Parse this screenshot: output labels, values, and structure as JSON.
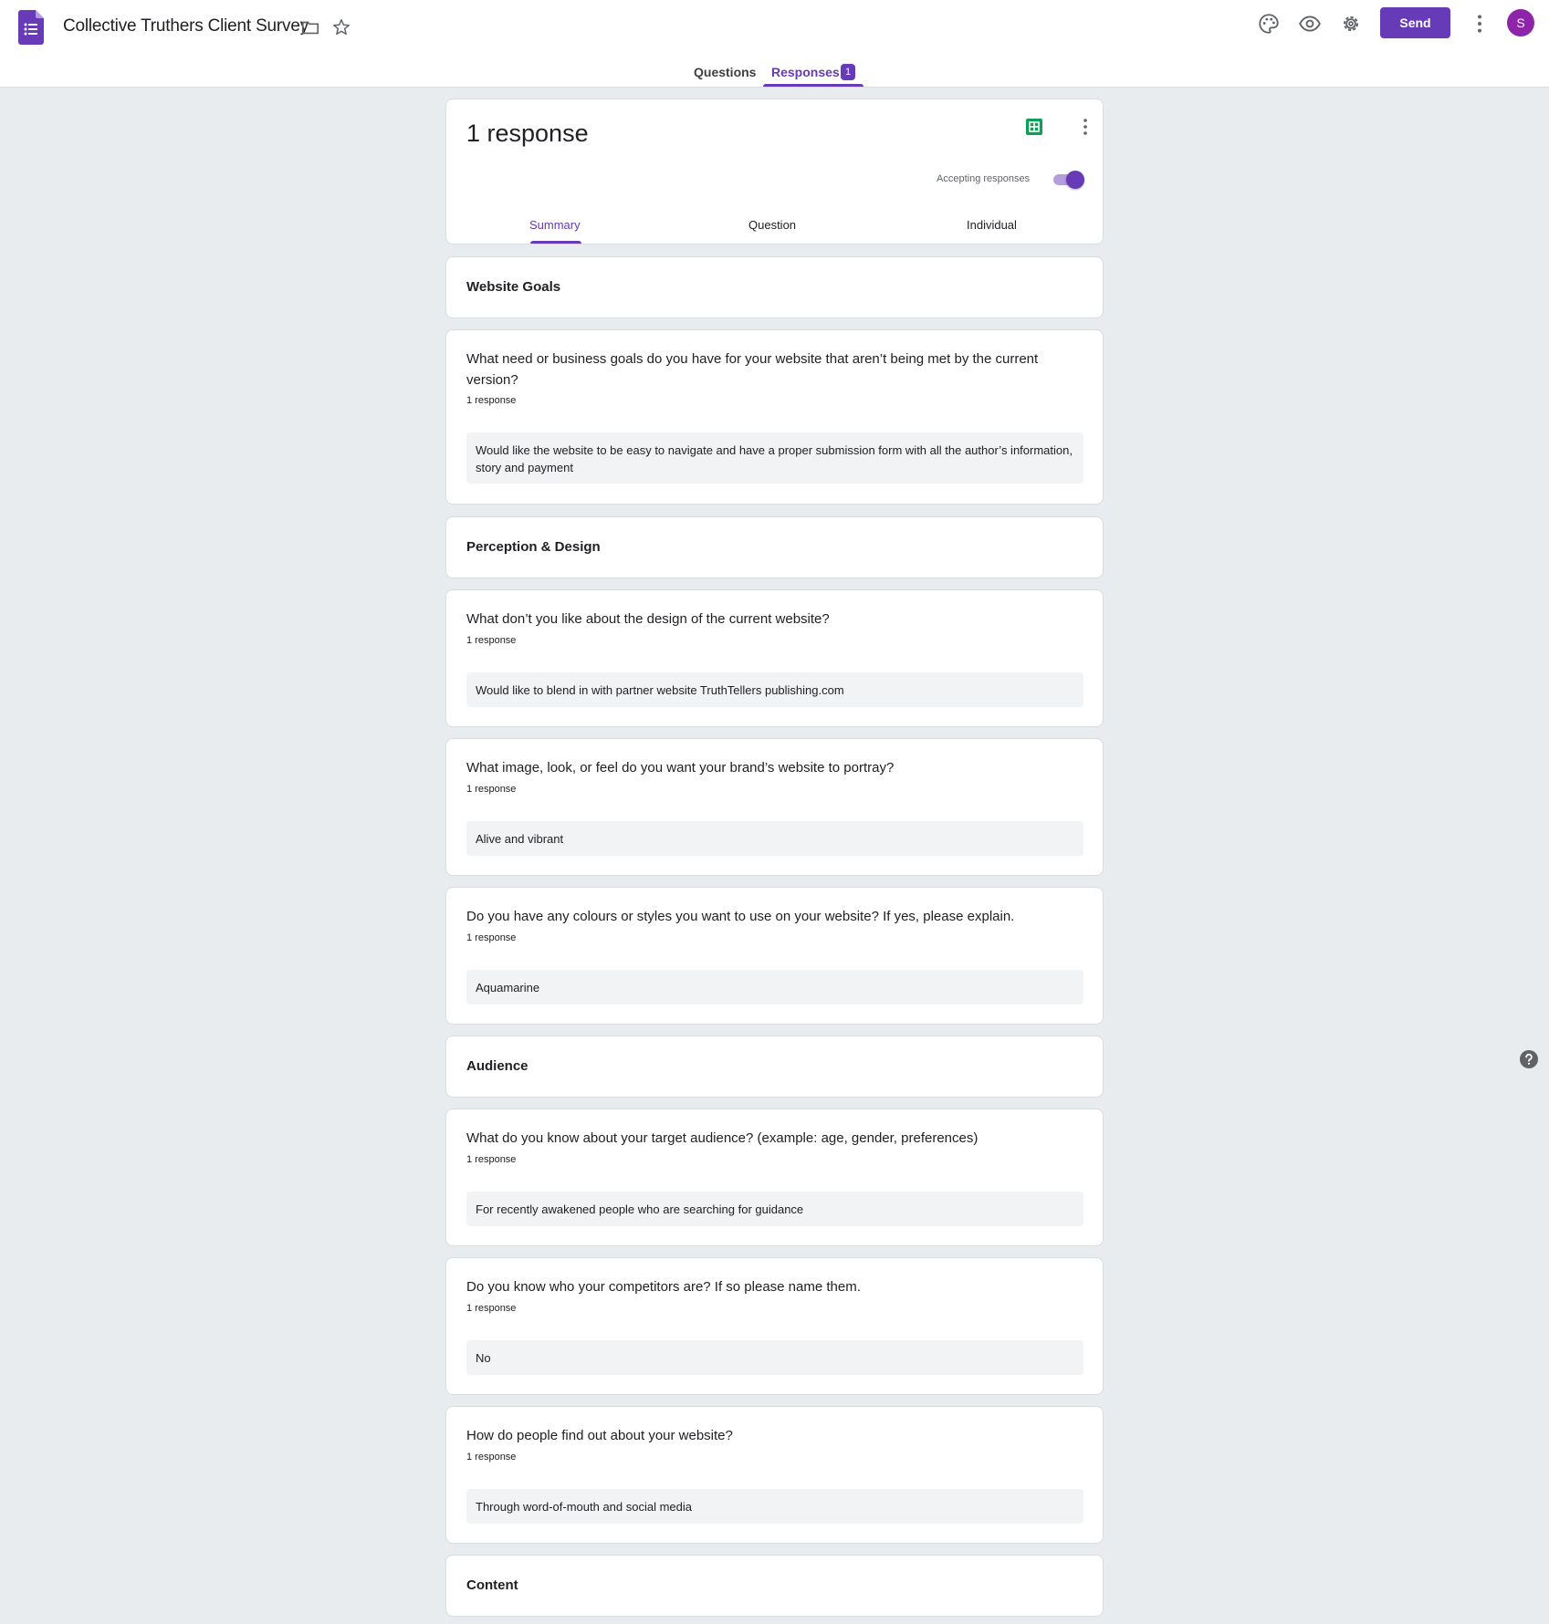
{
  "header": {
    "title": "Collective Truthers Client Survey",
    "send_label": "Send",
    "avatar_initial": "S",
    "icons": [
      "forms-app-icon",
      "folder-icon",
      "star-icon",
      "palette-icon",
      "eye-icon",
      "gear-icon",
      "more-vert-icon"
    ]
  },
  "main_tabs": {
    "questions": "Questions",
    "responses": "Responses",
    "responses_badge": "1"
  },
  "summary": {
    "count_label": "1 response",
    "accepting_label": "Accepting responses",
    "accepting": true,
    "tabs": [
      "Summary",
      "Question",
      "Individual"
    ]
  },
  "sections": [
    {
      "title": "Website Goals"
    },
    {
      "title": "Perception & Design"
    },
    {
      "title": "Audience"
    },
    {
      "title": "Content"
    }
  ],
  "questions": [
    {
      "title": "What need or business goals do you have for your website that aren’t being met by the current version?",
      "count": "1 response",
      "answer": "Would like the website to be easy to navigate and have a proper submission form with all the author’s information, story and payment"
    },
    {
      "title": "What don’t you like about the design of the current website?",
      "count": "1 response",
      "answer": "Would like to blend in with partner website TruthTellers publishing.com"
    },
    {
      "title": "What image, look, or feel do you want your brand’s website to portray?",
      "count": "1 response",
      "answer": "Alive and vibrant"
    },
    {
      "title": "Do you have any colours or styles you want to use on your website? If yes, please explain.",
      "count": "1 response",
      "answer": "Aquamarine"
    },
    {
      "title": "What do you know about your target audience? (example: age, gender, preferences)",
      "count": "1 response",
      "answer": "For recently awakened people who are searching for guidance"
    },
    {
      "title": "Do you know who your competitors are? If so please name them.",
      "count": "1 response",
      "answer": "No"
    },
    {
      "title": "How do people find out about your website?",
      "count": "1 response",
      "answer": "Through word-of-mouth and social media"
    }
  ],
  "colors": {
    "accent": "#673ab7",
    "avatar": "#8e24aa",
    "sheets_green": "#0f9d58",
    "background": "#e8ecef"
  }
}
